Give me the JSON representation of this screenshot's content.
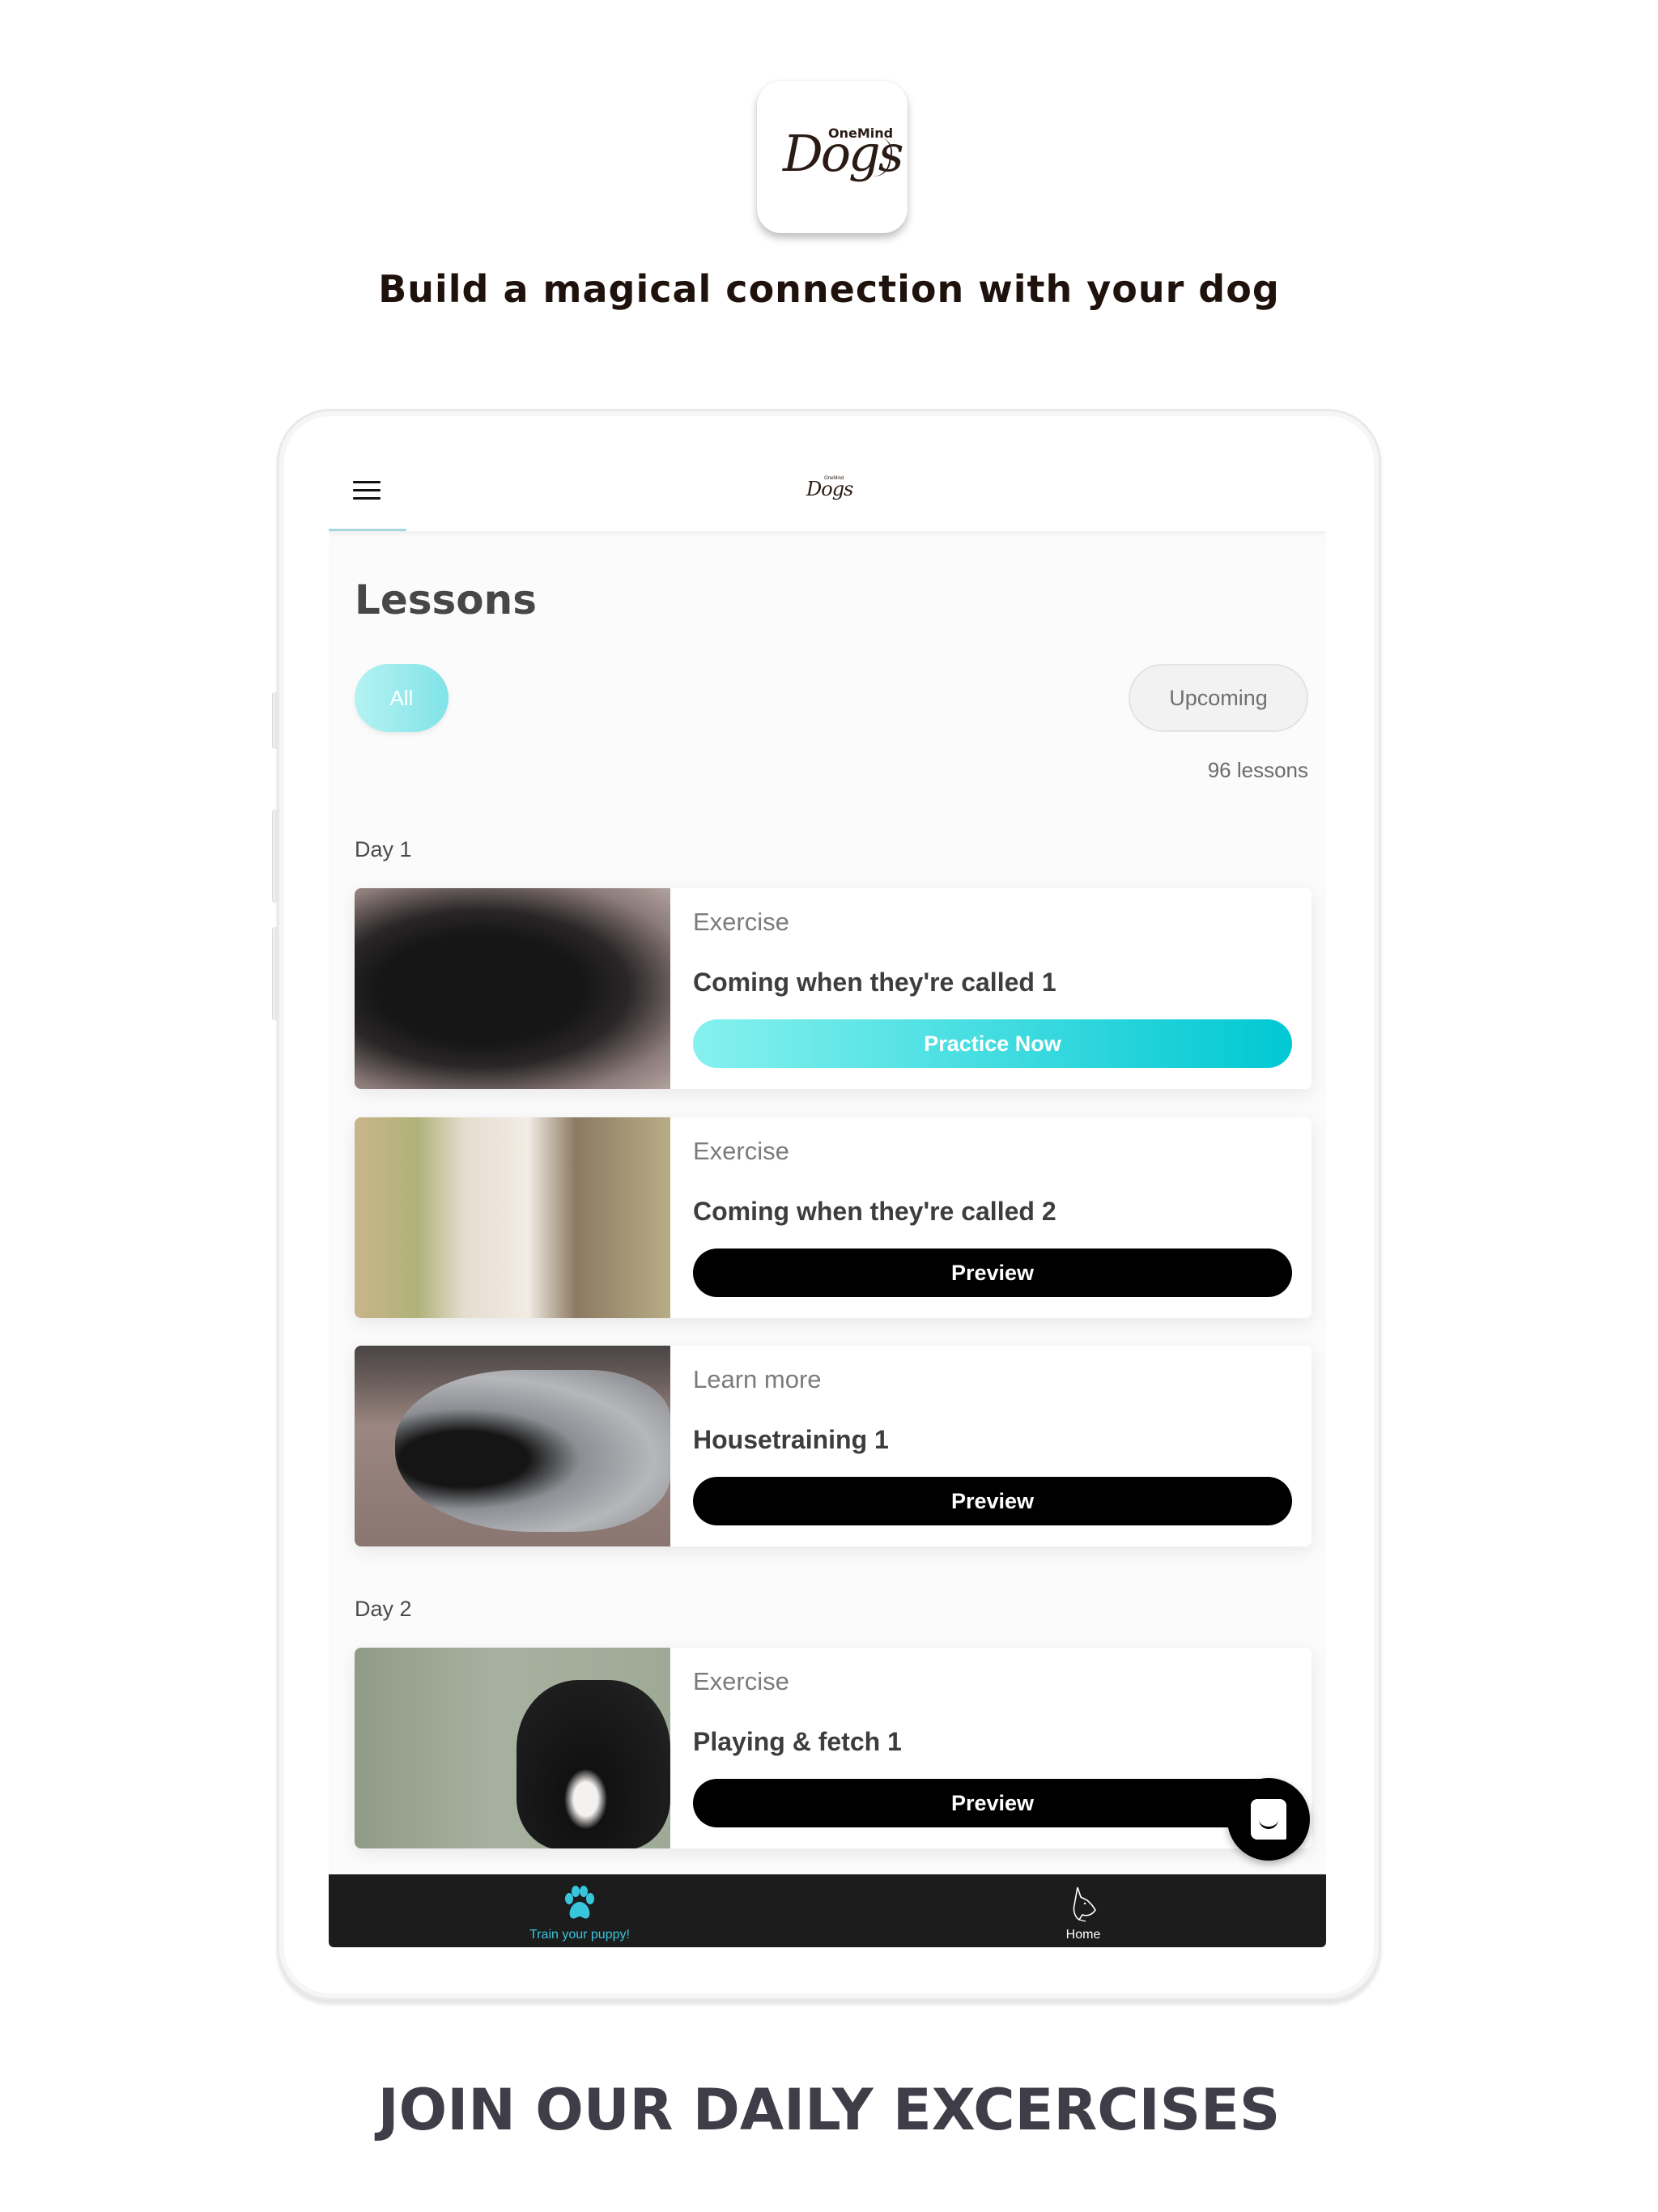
{
  "branding": {
    "logo_small_text": "OneMind",
    "logo_main_text": "Dogs",
    "tagline": "Build a magical connection with your dog",
    "caption": "JOIN OUR DAILY EXCERCISES"
  },
  "app": {
    "header": {
      "menu_icon": "hamburger-menu-icon",
      "logo_small_text": "OneMind",
      "logo_main_text": "Dogs"
    },
    "page_title": "Lessons",
    "filters": {
      "all_label": "All",
      "upcoming_label": "Upcoming",
      "active": "All"
    },
    "lesson_count": "96 lessons",
    "sections": [
      {
        "label": "Day 1",
        "lessons": [
          {
            "type": "Exercise",
            "title": "Coming when they're called 1",
            "button": "Practice Now",
            "button_style": "primary"
          },
          {
            "type": "Exercise",
            "title": "Coming when they're called 2",
            "button": "Preview",
            "button_style": "secondary"
          },
          {
            "type": "Learn more",
            "title": "Housetraining 1",
            "button": "Preview",
            "button_style": "secondary"
          }
        ]
      },
      {
        "label": "Day 2",
        "lessons": [
          {
            "type": "Exercise",
            "title": "Playing & fetch 1",
            "button": "Preview",
            "button_style": "secondary"
          }
        ]
      }
    ],
    "chat_button_icon": "chat-bubble-icon",
    "bottom_nav": [
      {
        "label": "Train your puppy!",
        "icon": "paw-icon",
        "active": true
      },
      {
        "label": "Home",
        "icon": "dog-head-icon",
        "active": false
      }
    ]
  },
  "colors": {
    "accent_gradient_start": "#86f1ee",
    "accent_gradient_end": "#00c8d3",
    "nav_active": "#38c6dc",
    "nav_background": "#1c1c1c",
    "tagline": "#1f120c",
    "caption": "#3f3d48"
  }
}
